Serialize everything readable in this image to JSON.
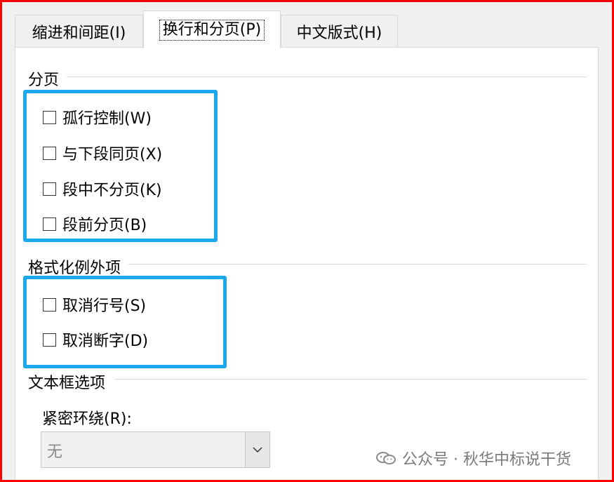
{
  "tabs": [
    {
      "label": "缩进和间距(I)"
    },
    {
      "label": "换行和分页(P)"
    },
    {
      "label": "中文版式(H)"
    }
  ],
  "pagination": {
    "title": "分页",
    "options": [
      {
        "label": "孤行控制(W)",
        "checked": false
      },
      {
        "label": "与下段同页(X)",
        "checked": false
      },
      {
        "label": "段中不分页(K)",
        "checked": false
      },
      {
        "label": "段前分页(B)",
        "checked": false
      }
    ]
  },
  "formatting_exceptions": {
    "title": "格式化例外项",
    "options": [
      {
        "label": "取消行号(S)",
        "checked": false
      },
      {
        "label": "取消断字(D)",
        "checked": false
      }
    ]
  },
  "textbox_options": {
    "title": "文本框选项",
    "tight_wrap_label": "紧密环绕(R):",
    "tight_wrap_value": "无"
  },
  "watermark": {
    "text": "公众号 · 秋华中标说干货",
    "icon": "wechat-icon"
  },
  "colors": {
    "highlight": "#1aa8ee",
    "frame": "#ff0000"
  }
}
